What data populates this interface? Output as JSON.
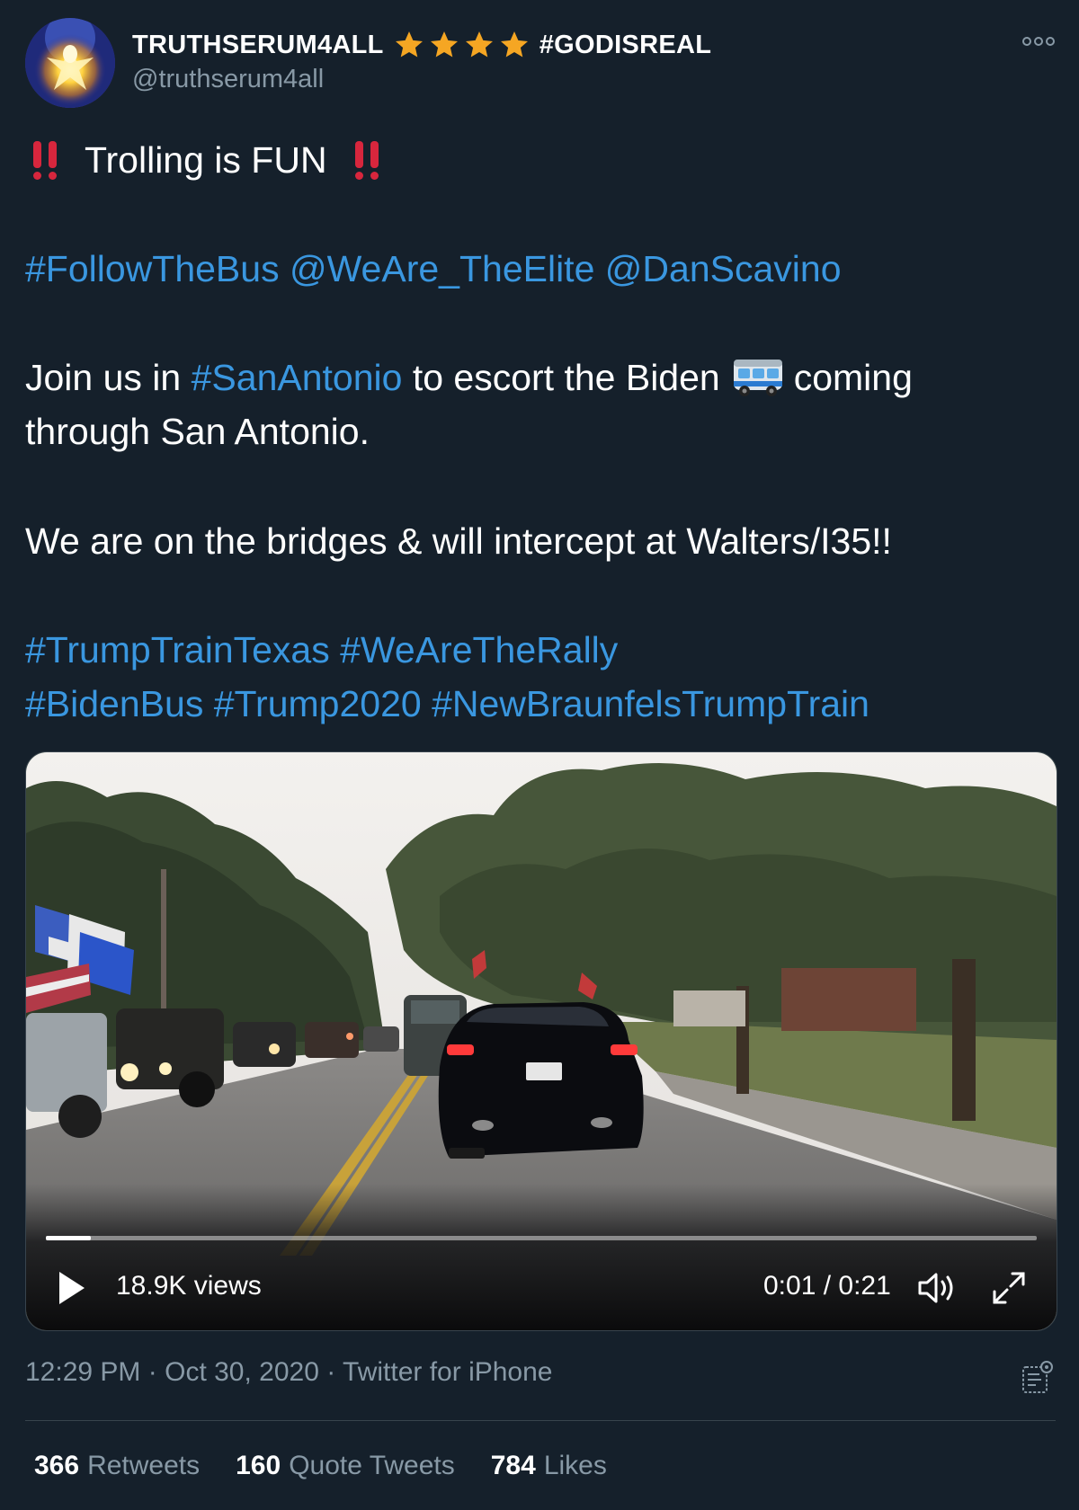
{
  "user": {
    "display_name": "TRUTHSERUM4ALL",
    "star_count": 4,
    "name_suffix": "#GODISREAL",
    "handle": "@truthserum4all",
    "avatar_icon": "glowing-figure-avatar"
  },
  "tweet": {
    "line1_text": "Trolling is FUN",
    "line1_emoji": "double-exclamation-icon",
    "line2_links": [
      "#FollowTheBus",
      "@WeAre_TheElite",
      "@DanScavino"
    ],
    "line3_pre": "Join us in",
    "line3_link": "#SanAntonio",
    "line3_post": "to escort the Biden",
    "line3_emoji": "bus-icon",
    "line3_end": "coming",
    "line4": "through San Antonio.",
    "line5": "We are on the bridges & will intercept at Walters/I35!!",
    "line6_links": [
      "#TrumpTrainTexas",
      "#WeAreTheRally"
    ],
    "line7_links": [
      "#BidenBus",
      "#Trump2020",
      "#NewBraunfelsTrumpTrain"
    ]
  },
  "video": {
    "views": "18.9K views",
    "time": "0:01 / 0:21",
    "progress": 0.045
  },
  "meta": {
    "time": "12:29 PM",
    "date": "Oct 30, 2020",
    "separator": "·",
    "source": "Twitter for iPhone"
  },
  "stats": [
    {
      "count": "366",
      "label": "Retweets"
    },
    {
      "count": "160",
      "label": "Quote Tweets"
    },
    {
      "count": "784",
      "label": "Likes"
    }
  ],
  "colors": {
    "background": "#15202b",
    "link": "#3a97e0",
    "secondary_text": "#8899a6",
    "star": "#f5a623",
    "emoji_red": "#d7263d"
  }
}
